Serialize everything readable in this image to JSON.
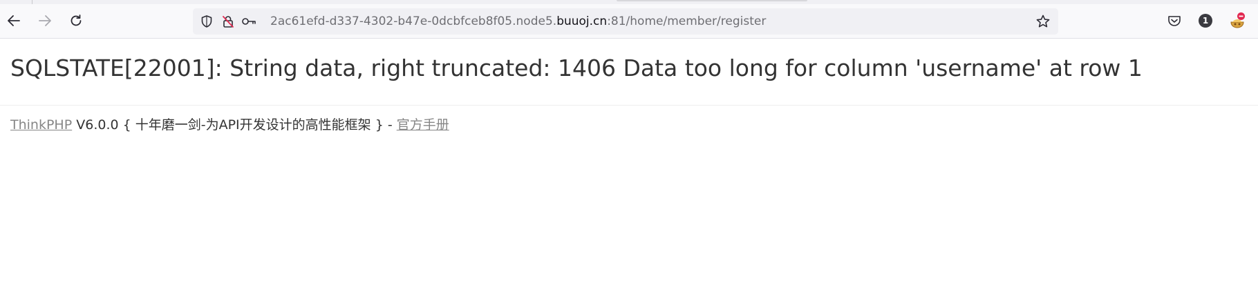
{
  "browser": {
    "nav": {
      "back_icon": "arrow-left-icon",
      "forward_icon": "arrow-right-icon",
      "reload_icon": "reload-icon"
    },
    "urlbar": {
      "url_prefix": "2ac61efd-d337-4302-b47e-0dcbfceb8f05.node5.",
      "url_domain": "buuoj.cn",
      "url_suffix": ":81/home/member/register",
      "icons": [
        "shield-icon",
        "insecure-lock-icon",
        "key-icon",
        "star-icon"
      ]
    },
    "toolbar_right": {
      "pocket_icon": "pocket-icon",
      "notification_count": "1",
      "extension_icon": "extension-icon"
    }
  },
  "page": {
    "error_message": "SQLSTATE[22001]: String data, right truncated: 1406 Data too long for column 'username' at row 1",
    "framework_link": "ThinkPHP",
    "version_text": " V6.0.0 { 十年磨一剑-为API开发设计的高性能框架 } - ",
    "manual_link": "官方手册",
    "colors": {
      "text": "#333333",
      "link": "#868686",
      "urlbar_bg": "#f0f0f4",
      "toolbar_bg": "#f9f9fb"
    }
  }
}
